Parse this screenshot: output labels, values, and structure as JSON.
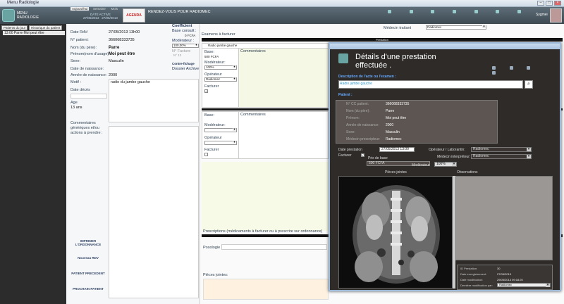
{
  "window": {
    "title": "Menu Radiologie"
  },
  "header": {
    "menu_label": "MENU",
    "module_label": "RADIOLOGIE",
    "tabs": [
      "Aujourd'hui",
      "Semaine",
      "Mois"
    ],
    "date_active_label": "DATE ACTIVE",
    "date_active": "27/05/2013",
    "date_active2": "27/05/2013",
    "agenda": "AGENDA",
    "page_title": "RENDEZ-VOUS POUR RADIOMEC",
    "user": "Sygmei"
  },
  "sidebar": {
    "tabs": [
      "Patients du jour",
      "Historique du patient"
    ],
    "item": {
      "time": "13:00",
      "name": "Parre Moi peut être"
    }
  },
  "patient": {
    "date_rdv_label": "Date RdV:",
    "date_rdv": "27/05/2013 13h00",
    "num_label": "N° patient:",
    "num": "366068333735",
    "nom_label": "Nom (du père):",
    "nom": "Parre",
    "prenom_label": "Prénom(nom d'usage)",
    "prenom": "Moi peut être",
    "sexe_label": "Sexe:",
    "sexe": "Masculin",
    "date_naiss_label": "Date de naissance:",
    "annee_naiss_label": "Année de naissance:",
    "annee_naiss": "2000",
    "motif_label": "Motif :",
    "motif": "radio du jambe gauche",
    "date_deces_label": "Date décès",
    "age_label": "Age",
    "age": "13 ans",
    "comments_label": "Commentaires génériques et/ou actions à prendre :",
    "print_label": "IMPRIMER L'ORDONNANCE",
    "new_rdv_label": "Nouveau RDV",
    "prev_label": "PATIENT PRECEDENT",
    "next_label": "PROCHAIN PATIENT"
  },
  "coef": {
    "coef_label": "Coefficient",
    "base_label": "Base consult :",
    "base_val": "0 FCFA",
    "mod_label": "Modérateur :",
    "mod_val": "100,00%",
    "facture_label": "N° Facture",
    "facture_val": "N° 12",
    "counter_label": "Contre-fichage",
    "dossier_label": "Dossier Archive"
  },
  "main": {
    "medecin_label": "Médecin traitant",
    "medecin": "Radiomec",
    "exams_label": "Examens à facturer",
    "prestation_bar": "Prestation",
    "exam1": {
      "title": "Radio jambe gauche",
      "base_label": "Base:",
      "base_val": "500 FCFA",
      "mod_label": "Modérateur:",
      "mod_val": "100%",
      "op_label": "Opérateur",
      "op_val": "Radiomec",
      "fact_label": "Facturer",
      "comments_label": "Commentaires"
    },
    "exam2": {
      "base_label": "Base:",
      "mod_label": "Modérateur:",
      "op_label": "Opérateur",
      "fact_label": "Facturer",
      "comments_label": "Commentaires"
    },
    "prescriptions_label": "Prescriptions (médicaments à facturer ou à prescrire sur ordonnance)",
    "posologie_label": "Posologie :",
    "pieces_label": "Pièces jointes:"
  },
  "dialog": {
    "title_line1": "Détails d'une prestation",
    "title_line2": "effectuée .",
    "desc_label": "Description de l'acte ou l'examen :",
    "desc_val": "Radio jambe gauche",
    "patient_label": "Patient :",
    "fields": [
      {
        "label": "N° CC patient:",
        "value": "366068333735"
      },
      {
        "label": "Nom (du père):",
        "value": "Parre"
      },
      {
        "label": "Prénom:",
        "value": "Moi peut être"
      },
      {
        "label": "Année de naissance:",
        "value": "2000"
      },
      {
        "label": "Sexe:",
        "value": "Masculin"
      },
      {
        "label": "Médecin prescripteur:",
        "value": "Radiomec"
      }
    ],
    "date_prest_label": "Date prestation",
    "date_prest": "27/05/2013 13:00",
    "facturer_label": "Facturer",
    "prix_label": "Prix de base",
    "prix_val": "500 FCFA",
    "mod_label": "Modérateur",
    "mod_val": "100%",
    "operateur_label": "Opérateur / Laborantin:",
    "operateur_val": "Radiomec",
    "interp_label": "Médecin interpréteur:",
    "interp_val": "Radiomec",
    "pieces_label": "Pièces jointes",
    "obs_label": "Observations",
    "meta": [
      {
        "label": "ID Prestation:",
        "value": "30"
      },
      {
        "label": "Date enregistrement:",
        "value": "27/05/2013"
      },
      {
        "label": "Date modification:",
        "value": "29/05/2013 09:18:20"
      },
      {
        "label": "Dernière modification par:",
        "value": "Radiomec"
      }
    ]
  },
  "colors": {
    "dark_header": "#3e4a52",
    "dialog_bg": "#2e2b29",
    "accent": "#66aaff"
  }
}
